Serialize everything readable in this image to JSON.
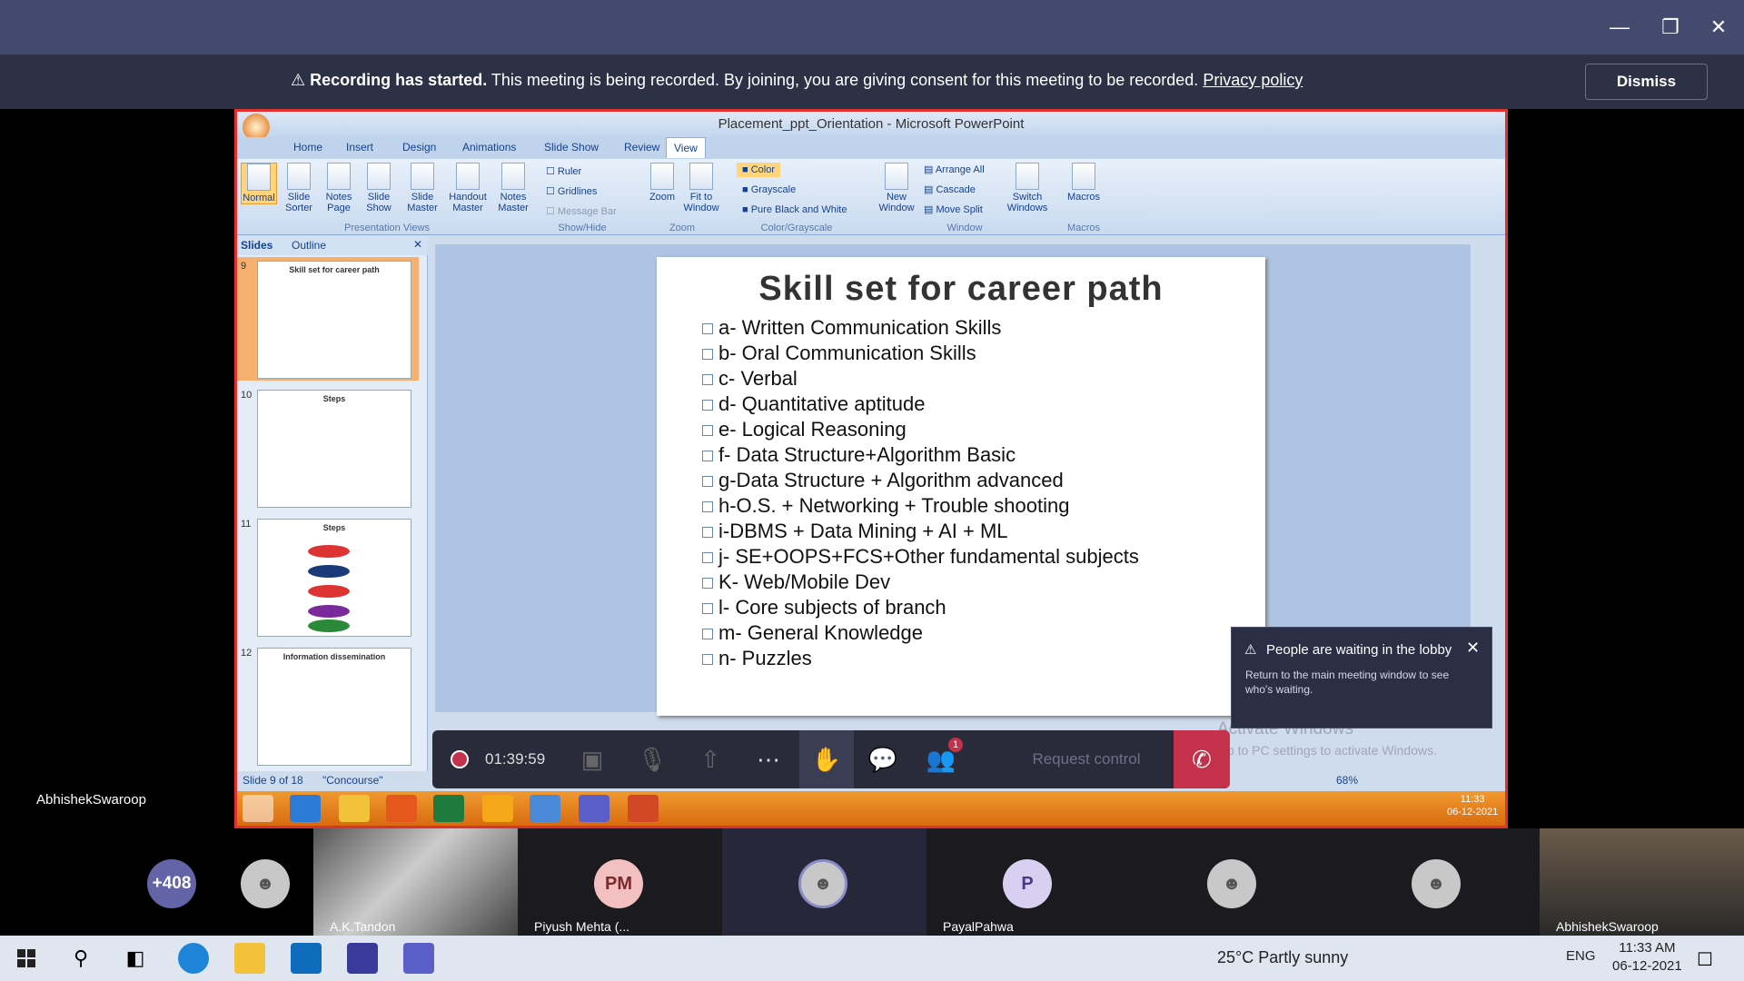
{
  "banner": {
    "bold": "Recording has started.",
    "text": " This meeting is being recorded. By joining, you are giving consent for this meeting to be recorded. ",
    "link": "Privacy policy",
    "dismiss": "Dismiss"
  },
  "ppt": {
    "title": "Placement_ppt_Orientation - Microsoft PowerPoint",
    "tabs": [
      "Home",
      "Insert",
      "Design",
      "Animations",
      "Slide Show",
      "Review",
      "View"
    ],
    "ribbon": {
      "normal": "Normal",
      "slide_sorter": "Slide Sorter",
      "notes_page": "Notes Page",
      "slide_show": "Slide Show",
      "slide_master": "Slide Master",
      "handout_master": "Handout Master",
      "notes_master": "Notes Master",
      "ruler": "Ruler",
      "gridlines": "Gridlines",
      "message_bar": "Message Bar",
      "zoom": "Zoom",
      "fit_to_window": "Fit to Window",
      "color": "Color",
      "grayscale": "Grayscale",
      "pure_bw": "Pure Black and White",
      "new_window": "New Window",
      "arrange_all": "Arrange All",
      "cascade": "Cascade",
      "move_split": "Move Split",
      "switch_windows": "Switch Windows",
      "macros": "Macros",
      "groups": [
        "Presentation Views",
        "Show/Hide",
        "Zoom",
        "Color/Grayscale",
        "Window",
        "Macros"
      ]
    },
    "panel_tabs": [
      "Slides",
      "Outline"
    ],
    "thumbs": [
      {
        "num": "9",
        "title": "Skill set for career path"
      },
      {
        "num": "10",
        "title": "Steps"
      },
      {
        "num": "11",
        "title": "Steps"
      },
      {
        "num": "12",
        "title": "Information dissemination"
      }
    ],
    "slide": {
      "title": "Skill set for career path",
      "bullets": [
        "a- Written Communication Skills",
        "b- Oral Communication Skills",
        "c- Verbal",
        "d- Quantitative aptitude",
        "e- Logical Reasoning",
        "f- Data Structure+Algorithm Basic",
        "g-Data Structure + Algorithm advanced",
        "h-O.S. + Networking + Trouble shooting",
        "i-DBMS + Data Mining + AI + ML",
        "j- SE+OOPS+FCS+Other fundamental subjects",
        "K- Web/Mobile Dev",
        "l- Core subjects of branch",
        "m- General Knowledge",
        "n- Puzzles"
      ]
    },
    "status": {
      "slide": "Slide 9 of 18",
      "theme": "\"Concourse\"",
      "zoom": "68%"
    },
    "inner_clock": {
      "time": "11:33",
      "date": "06-12-2021"
    }
  },
  "lobby": {
    "title": "People are waiting in the lobby",
    "desc": "Return to the main meeting window to see who's waiting."
  },
  "watermark": {
    "line1": "Activate Windows",
    "line2": "Go to PC settings to activate Windows."
  },
  "controls": {
    "timer": "01:39:59",
    "request": "Request control",
    "badge": "1"
  },
  "presenter": "AbhishekSwaroop",
  "participants": {
    "overflow": "+408",
    "tiles": [
      {
        "name": "A.K.Tandon"
      },
      {
        "initials": "PM",
        "name": "Piyush Mehta (..."
      },
      {
        "initials": "P",
        "name": "PayalPahwa"
      },
      {
        "name": "AbhishekSwaroop"
      }
    ]
  },
  "taskbar": {
    "weather": "25°C  Partly sunny",
    "lang": "ENG",
    "time": "11:33 AM",
    "date": "06-12-2021"
  },
  "colors": {
    "accent": "#444a6e",
    "banner": "#2d3145",
    "hangup": "#c4314b",
    "share_border": "#e0312f"
  }
}
